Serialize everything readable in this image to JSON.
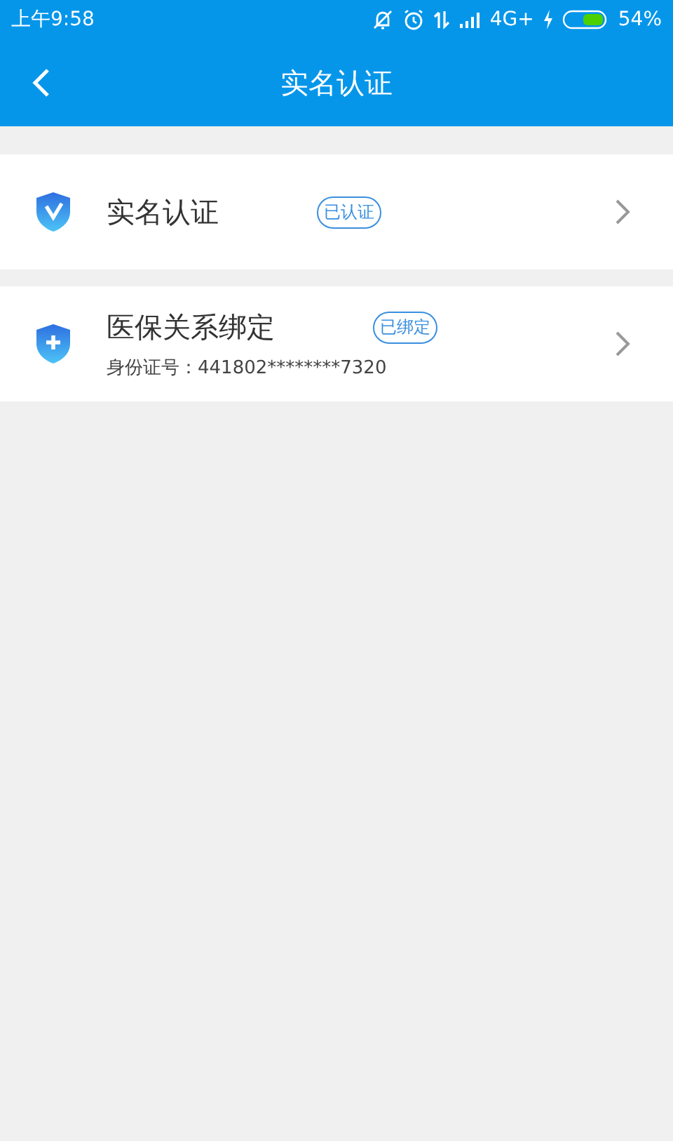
{
  "status_bar": {
    "time": "上午9:58",
    "network": "4G+",
    "battery": "54%"
  },
  "header": {
    "title": "实名认证"
  },
  "items": [
    {
      "kind": "verify",
      "title": "实名认证",
      "badge": "已认证"
    },
    {
      "kind": "insurance",
      "title": "医保关系绑定",
      "badge": "已绑定",
      "subtitle": "身份证号：441802********7320"
    }
  ]
}
